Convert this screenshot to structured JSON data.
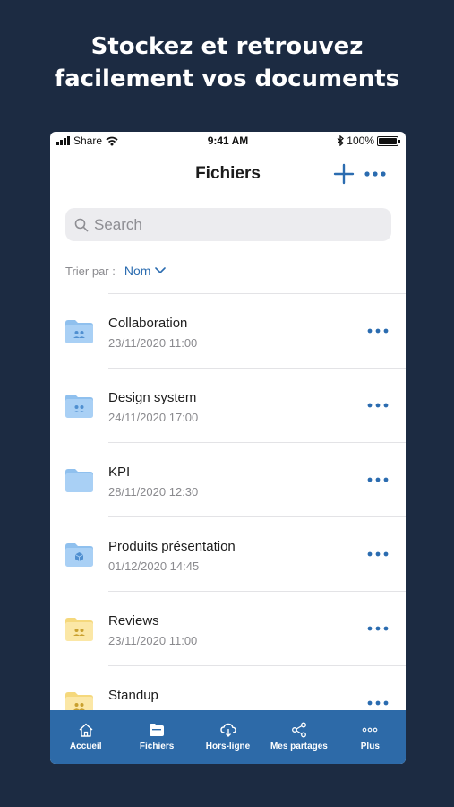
{
  "headline": {
    "line1": "Stockez et retrouvez",
    "line2": "facilement vos documents"
  },
  "status_bar": {
    "carrier": "Share",
    "time": "9:41 AM",
    "battery": "100%"
  },
  "nav": {
    "title": "Fichiers"
  },
  "search": {
    "placeholder": "Search"
  },
  "sort": {
    "label": "Trier par :",
    "value": "Nom"
  },
  "colors": {
    "background": "#1c2b42",
    "accent": "#2b6cb0",
    "tab_bar": "#2d6aa8",
    "folder_blue": "#a9d0f5",
    "folder_yellow": "#fbe7a6"
  },
  "files": [
    {
      "name": "Collaboration",
      "date": "23/11/2020  11:00",
      "icon": "shared-folder-icon",
      "color": "blue"
    },
    {
      "name": "Design system",
      "date": "24/11/2020  17:00",
      "icon": "shared-folder-icon",
      "color": "blue"
    },
    {
      "name": "KPI",
      "date": "28/11/2020  12:30",
      "icon": "folder-icon",
      "color": "blue"
    },
    {
      "name": "Produits présentation",
      "date": "01/12/2020  14:45",
      "icon": "box-folder-icon",
      "color": "blue"
    },
    {
      "name": "Reviews",
      "date": "23/11/2020  11:00",
      "icon": "shared-folder-icon",
      "color": "yellow"
    },
    {
      "name": "Standup",
      "date": "",
      "icon": "shared-folder-icon",
      "color": "yellow"
    }
  ],
  "tabs": [
    {
      "label": "Accueil",
      "icon": "home-icon"
    },
    {
      "label": "Fichiers",
      "icon": "folder-icon"
    },
    {
      "label": "Hors-ligne",
      "icon": "cloud-download-icon"
    },
    {
      "label": "Mes partages",
      "icon": "share-icon"
    },
    {
      "label": "Plus",
      "icon": "more-icon"
    }
  ]
}
